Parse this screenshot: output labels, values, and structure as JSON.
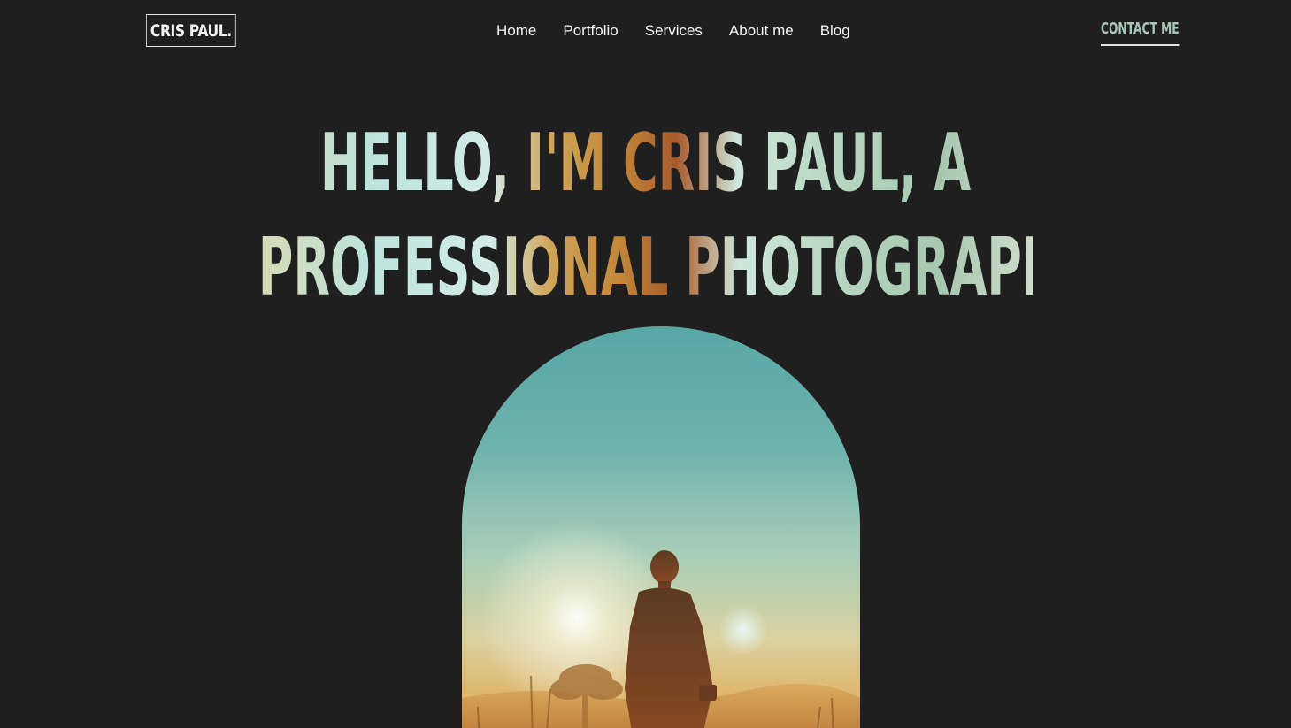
{
  "header": {
    "logo": "CRIS PAUL.",
    "nav": [
      "Home",
      "Portfolio",
      "Services",
      "About me",
      "Blog"
    ],
    "contact_label": "CONTACT ME"
  },
  "hero": {
    "headline_line1": "HELLO, I'M CRIS PAUL, A",
    "headline_line2": "PROFESSIONAL PHOTOGRAPHER."
  },
  "colors": {
    "background": "#1f1f1f",
    "accent_green": "#a7c8b4",
    "accent_orange": "#c48a3a"
  }
}
